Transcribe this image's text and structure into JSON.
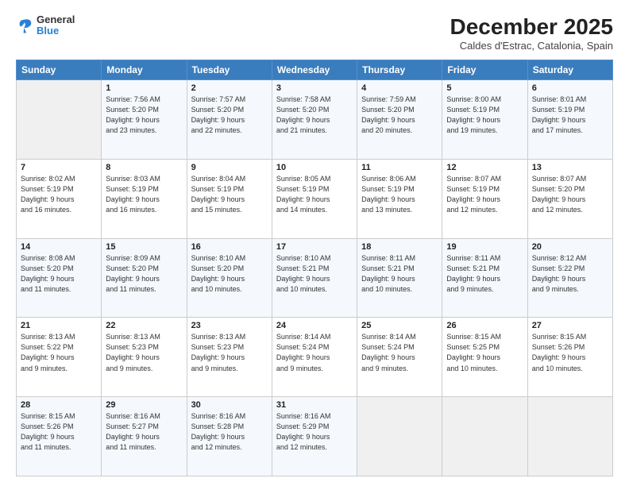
{
  "header": {
    "logo_general": "General",
    "logo_blue": "Blue",
    "month_title": "December 2025",
    "location": "Caldes d'Estrac, Catalonia, Spain"
  },
  "weekdays": [
    "Sunday",
    "Monday",
    "Tuesday",
    "Wednesday",
    "Thursday",
    "Friday",
    "Saturday"
  ],
  "weeks": [
    [
      {
        "day": "",
        "info": ""
      },
      {
        "day": "1",
        "info": "Sunrise: 7:56 AM\nSunset: 5:20 PM\nDaylight: 9 hours\nand 23 minutes."
      },
      {
        "day": "2",
        "info": "Sunrise: 7:57 AM\nSunset: 5:20 PM\nDaylight: 9 hours\nand 22 minutes."
      },
      {
        "day": "3",
        "info": "Sunrise: 7:58 AM\nSunset: 5:20 PM\nDaylight: 9 hours\nand 21 minutes."
      },
      {
        "day": "4",
        "info": "Sunrise: 7:59 AM\nSunset: 5:20 PM\nDaylight: 9 hours\nand 20 minutes."
      },
      {
        "day": "5",
        "info": "Sunrise: 8:00 AM\nSunset: 5:19 PM\nDaylight: 9 hours\nand 19 minutes."
      },
      {
        "day": "6",
        "info": "Sunrise: 8:01 AM\nSunset: 5:19 PM\nDaylight: 9 hours\nand 17 minutes."
      }
    ],
    [
      {
        "day": "7",
        "info": "Sunrise: 8:02 AM\nSunset: 5:19 PM\nDaylight: 9 hours\nand 16 minutes."
      },
      {
        "day": "8",
        "info": "Sunrise: 8:03 AM\nSunset: 5:19 PM\nDaylight: 9 hours\nand 16 minutes."
      },
      {
        "day": "9",
        "info": "Sunrise: 8:04 AM\nSunset: 5:19 PM\nDaylight: 9 hours\nand 15 minutes."
      },
      {
        "day": "10",
        "info": "Sunrise: 8:05 AM\nSunset: 5:19 PM\nDaylight: 9 hours\nand 14 minutes."
      },
      {
        "day": "11",
        "info": "Sunrise: 8:06 AM\nSunset: 5:19 PM\nDaylight: 9 hours\nand 13 minutes."
      },
      {
        "day": "12",
        "info": "Sunrise: 8:07 AM\nSunset: 5:19 PM\nDaylight: 9 hours\nand 12 minutes."
      },
      {
        "day": "13",
        "info": "Sunrise: 8:07 AM\nSunset: 5:20 PM\nDaylight: 9 hours\nand 12 minutes."
      }
    ],
    [
      {
        "day": "14",
        "info": "Sunrise: 8:08 AM\nSunset: 5:20 PM\nDaylight: 9 hours\nand 11 minutes."
      },
      {
        "day": "15",
        "info": "Sunrise: 8:09 AM\nSunset: 5:20 PM\nDaylight: 9 hours\nand 11 minutes."
      },
      {
        "day": "16",
        "info": "Sunrise: 8:10 AM\nSunset: 5:20 PM\nDaylight: 9 hours\nand 10 minutes."
      },
      {
        "day": "17",
        "info": "Sunrise: 8:10 AM\nSunset: 5:21 PM\nDaylight: 9 hours\nand 10 minutes."
      },
      {
        "day": "18",
        "info": "Sunrise: 8:11 AM\nSunset: 5:21 PM\nDaylight: 9 hours\nand 10 minutes."
      },
      {
        "day": "19",
        "info": "Sunrise: 8:11 AM\nSunset: 5:21 PM\nDaylight: 9 hours\nand 9 minutes."
      },
      {
        "day": "20",
        "info": "Sunrise: 8:12 AM\nSunset: 5:22 PM\nDaylight: 9 hours\nand 9 minutes."
      }
    ],
    [
      {
        "day": "21",
        "info": "Sunrise: 8:13 AM\nSunset: 5:22 PM\nDaylight: 9 hours\nand 9 minutes."
      },
      {
        "day": "22",
        "info": "Sunrise: 8:13 AM\nSunset: 5:23 PM\nDaylight: 9 hours\nand 9 minutes."
      },
      {
        "day": "23",
        "info": "Sunrise: 8:13 AM\nSunset: 5:23 PM\nDaylight: 9 hours\nand 9 minutes."
      },
      {
        "day": "24",
        "info": "Sunrise: 8:14 AM\nSunset: 5:24 PM\nDaylight: 9 hours\nand 9 minutes."
      },
      {
        "day": "25",
        "info": "Sunrise: 8:14 AM\nSunset: 5:24 PM\nDaylight: 9 hours\nand 9 minutes."
      },
      {
        "day": "26",
        "info": "Sunrise: 8:15 AM\nSunset: 5:25 PM\nDaylight: 9 hours\nand 10 minutes."
      },
      {
        "day": "27",
        "info": "Sunrise: 8:15 AM\nSunset: 5:26 PM\nDaylight: 9 hours\nand 10 minutes."
      }
    ],
    [
      {
        "day": "28",
        "info": "Sunrise: 8:15 AM\nSunset: 5:26 PM\nDaylight: 9 hours\nand 11 minutes."
      },
      {
        "day": "29",
        "info": "Sunrise: 8:16 AM\nSunset: 5:27 PM\nDaylight: 9 hours\nand 11 minutes."
      },
      {
        "day": "30",
        "info": "Sunrise: 8:16 AM\nSunset: 5:28 PM\nDaylight: 9 hours\nand 12 minutes."
      },
      {
        "day": "31",
        "info": "Sunrise: 8:16 AM\nSunset: 5:29 PM\nDaylight: 9 hours\nand 12 minutes."
      },
      {
        "day": "",
        "info": ""
      },
      {
        "day": "",
        "info": ""
      },
      {
        "day": "",
        "info": ""
      }
    ]
  ]
}
